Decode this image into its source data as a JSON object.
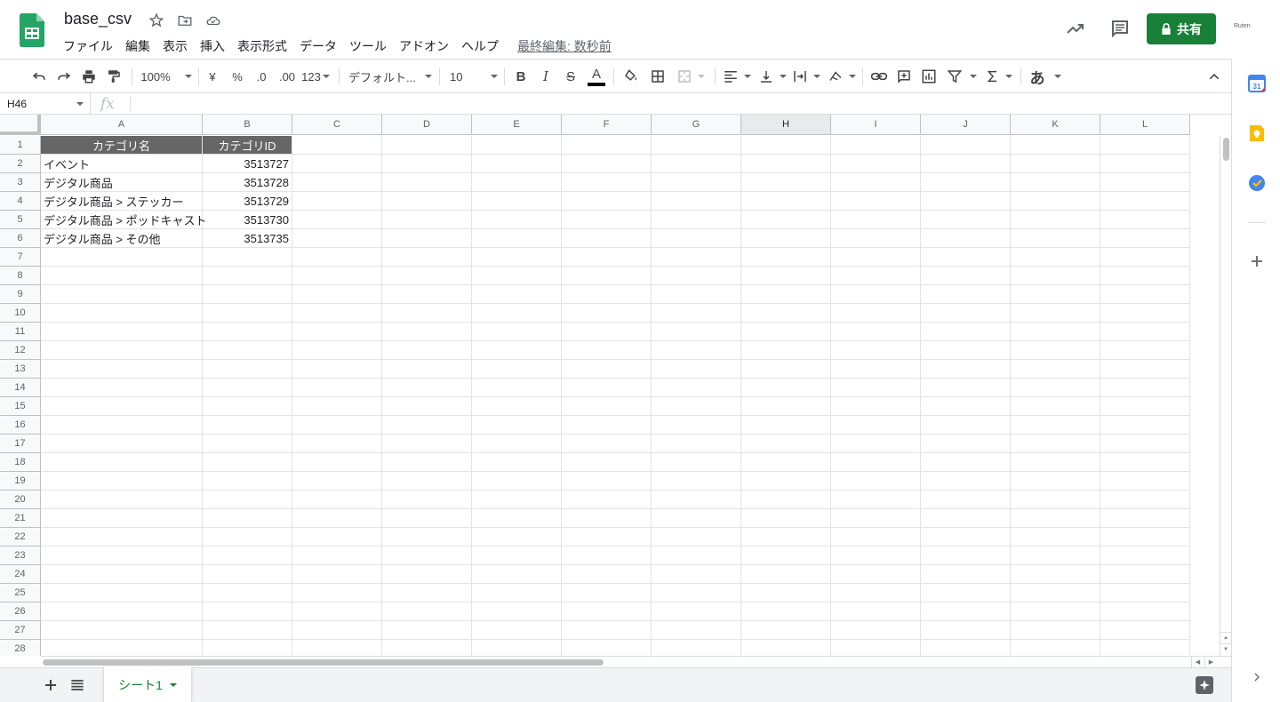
{
  "doc": {
    "title": "base_csv",
    "last_edit": "最終編集: 数秒前"
  },
  "menu": [
    {
      "id": "file",
      "label": "ファイル"
    },
    {
      "id": "edit",
      "label": "編集"
    },
    {
      "id": "view",
      "label": "表示"
    },
    {
      "id": "insert",
      "label": "挿入"
    },
    {
      "id": "format",
      "label": "表示形式"
    },
    {
      "id": "data",
      "label": "データ"
    },
    {
      "id": "tools",
      "label": "ツール"
    },
    {
      "id": "addons",
      "label": "アドオン"
    },
    {
      "id": "help",
      "label": "ヘルプ"
    }
  ],
  "header_right": {
    "share_label": "共有",
    "account_label": "Ruten"
  },
  "toolbar": {
    "zoom": "100%",
    "currency": "¥",
    "percent": "%",
    "dec_decrease": ".0",
    "dec_increase": ".00",
    "number_format": "123",
    "font": "デフォルト...",
    "font_size": "10",
    "bold": "B",
    "italic": "I",
    "strike": "S",
    "text_color": "A",
    "input_tool": "あ"
  },
  "formula": {
    "namebox": "H46",
    "fx": "fx"
  },
  "columns": [
    "A",
    "B",
    "C",
    "D",
    "E",
    "F",
    "G",
    "H",
    "I",
    "J",
    "K",
    "L"
  ],
  "selected_column": "H",
  "rows": [
    "1",
    "2",
    "3",
    "4",
    "5",
    "6",
    "7",
    "8",
    "9",
    "10",
    "11",
    "12",
    "13",
    "14",
    "15",
    "16",
    "17",
    "18",
    "19",
    "20",
    "21",
    "22",
    "23",
    "24",
    "25",
    "26",
    "27",
    "28"
  ],
  "table": {
    "headers": [
      "カテゴリ名",
      "カテゴリID"
    ],
    "rows": [
      [
        "イベント",
        "3513727"
      ],
      [
        "デジタル商品",
        "3513728"
      ],
      [
        "デジタル商品 > ステッカー",
        "3513729"
      ],
      [
        "デジタル商品 > ポッドキャスト",
        "3513730"
      ],
      [
        "デジタル商品 > その他",
        "3513735"
      ]
    ]
  },
  "sheets": [
    {
      "name": "シート1",
      "active": true
    }
  ],
  "colors": {
    "brand_green": "#188038",
    "header_fill": "#666666"
  }
}
